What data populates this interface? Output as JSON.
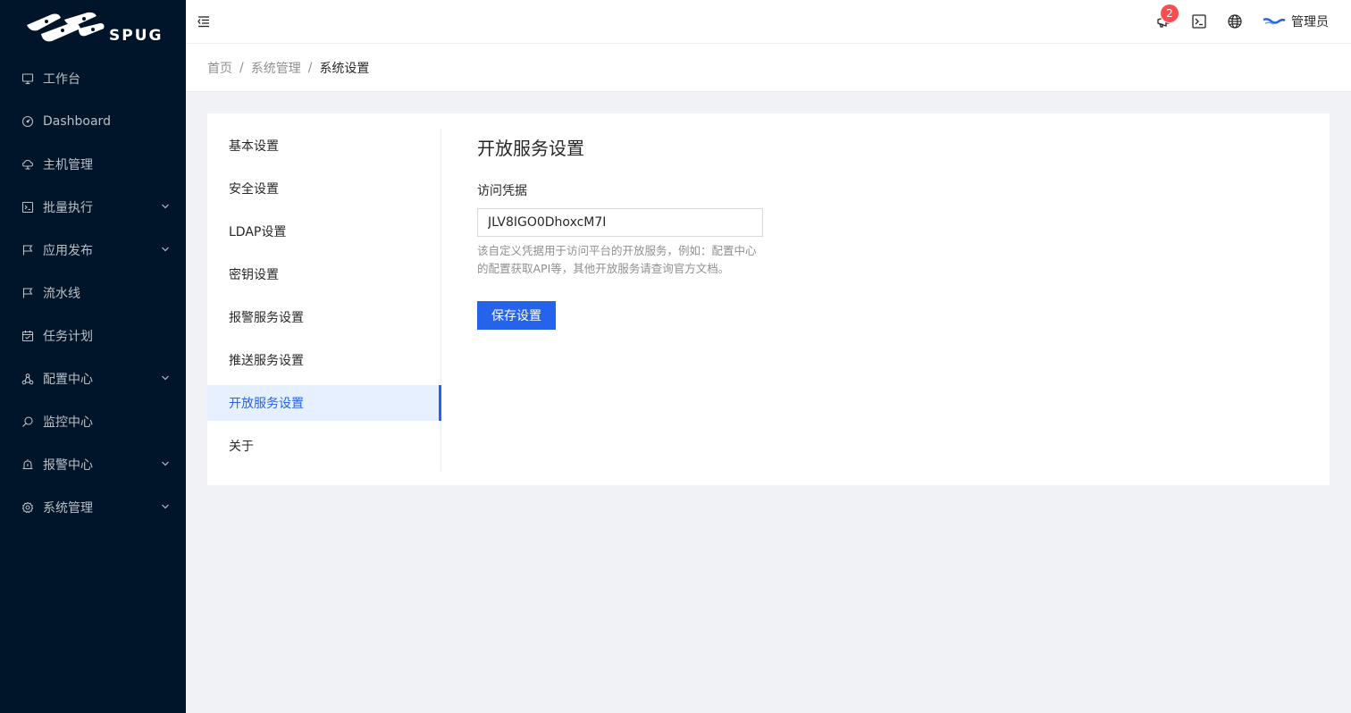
{
  "app": {
    "logo_text": "SPUG"
  },
  "sidebar": {
    "items": [
      {
        "label": "工作台",
        "icon": "desktop-icon",
        "has_submenu": false
      },
      {
        "label": "Dashboard",
        "icon": "dashboard-icon",
        "has_submenu": false
      },
      {
        "label": "主机管理",
        "icon": "cloud-server-icon",
        "has_submenu": false
      },
      {
        "label": "批量执行",
        "icon": "terminal-icon",
        "has_submenu": true
      },
      {
        "label": "应用发布",
        "icon": "flag-icon",
        "has_submenu": true
      },
      {
        "label": "流水线",
        "icon": "flag-icon",
        "has_submenu": false
      },
      {
        "label": "任务计划",
        "icon": "calendar-icon",
        "has_submenu": false
      },
      {
        "label": "配置中心",
        "icon": "deployment-unit-icon",
        "has_submenu": true
      },
      {
        "label": "监控中心",
        "icon": "monitor-icon",
        "has_submenu": false
      },
      {
        "label": "报警中心",
        "icon": "alert-icon",
        "has_submenu": true
      },
      {
        "label": "系统管理",
        "icon": "setting-icon",
        "has_submenu": true
      }
    ]
  },
  "header": {
    "notification_count": "2",
    "user_name": "管理员"
  },
  "breadcrumb": {
    "items": [
      "首页",
      "系统管理",
      "系统设置"
    ],
    "separator": "/"
  },
  "settings": {
    "menu": [
      "基本设置",
      "安全设置",
      "LDAP设置",
      "密钥设置",
      "报警服务设置",
      "推送服务设置",
      "开放服务设置",
      "关于"
    ],
    "active_index": 6,
    "panel": {
      "title": "开放服务设置",
      "field_label": "访问凭据",
      "field_value": "JLV8IGO0DhoxcM7I",
      "help_text": "该自定义凭据用于访问平台的开放服务，例如：配置中心的配置获取API等，其他开放服务请查询官方文档。",
      "save_label": "保存设置"
    }
  },
  "colors": {
    "sidebar_bg": "#001529",
    "primary": "#2563eb",
    "badge": "#ff4d4f",
    "page_bg": "#f0f2f5"
  }
}
